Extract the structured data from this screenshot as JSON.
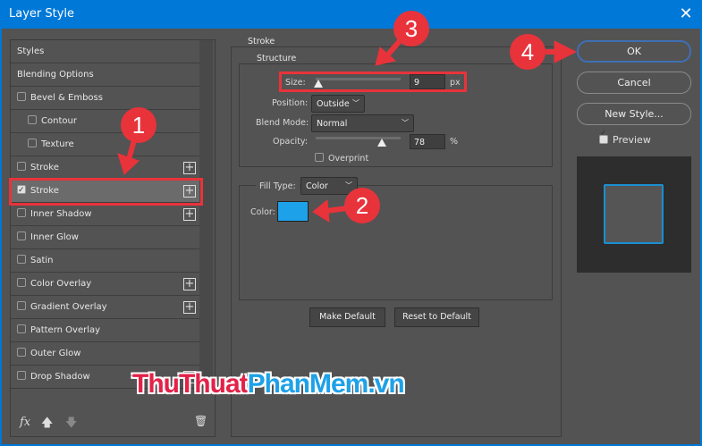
{
  "window": {
    "title": "Layer Style",
    "close": "✕"
  },
  "styles_list": [
    {
      "label": "Styles",
      "checkbox": null,
      "checked": false,
      "plus": false,
      "indent": false
    },
    {
      "label": "Blending Options",
      "checkbox": null,
      "checked": false,
      "plus": false,
      "indent": false
    },
    {
      "label": "Bevel & Emboss",
      "checkbox": true,
      "checked": false,
      "plus": false,
      "indent": false
    },
    {
      "label": "Contour",
      "checkbox": true,
      "checked": false,
      "plus": false,
      "indent": true
    },
    {
      "label": "Texture",
      "checkbox": true,
      "checked": false,
      "plus": false,
      "indent": true
    },
    {
      "label": "Stroke",
      "checkbox": true,
      "checked": false,
      "plus": true,
      "indent": false
    },
    {
      "label": "Stroke",
      "checkbox": true,
      "checked": true,
      "plus": true,
      "indent": false,
      "selected": true
    },
    {
      "label": "Inner Shadow",
      "checkbox": true,
      "checked": false,
      "plus": true,
      "indent": false
    },
    {
      "label": "Inner Glow",
      "checkbox": true,
      "checked": false,
      "plus": false,
      "indent": false
    },
    {
      "label": "Satin",
      "checkbox": true,
      "checked": false,
      "plus": false,
      "indent": false
    },
    {
      "label": "Color Overlay",
      "checkbox": true,
      "checked": false,
      "plus": true,
      "indent": false
    },
    {
      "label": "Gradient Overlay",
      "checkbox": true,
      "checked": false,
      "plus": true,
      "indent": false
    },
    {
      "label": "Pattern Overlay",
      "checkbox": true,
      "checked": false,
      "plus": false,
      "indent": false
    },
    {
      "label": "Outer Glow",
      "checkbox": true,
      "checked": false,
      "plus": false,
      "indent": false
    },
    {
      "label": "Drop Shadow",
      "checkbox": true,
      "checked": false,
      "plus": true,
      "indent": false
    }
  ],
  "footer": {
    "fx": "fx",
    "up": "🡅",
    "down": "🡇",
    "trash": "🗑"
  },
  "stroke": {
    "title": "Stroke",
    "structure": {
      "title": "Structure",
      "size_label": "Size:",
      "size_value": "9",
      "size_unit": "px",
      "size_slider": 0.03,
      "position_label": "Position:",
      "position_value": "Outside",
      "blend_label": "Blend Mode:",
      "blend_value": "Normal",
      "opacity_label": "Opacity:",
      "opacity_value": "78",
      "opacity_unit": "%",
      "opacity_slider": 0.78,
      "overprint_label": "Overprint",
      "overprint_checked": false
    },
    "fill_type_label": "Fill Type:",
    "fill_type_value": "Color",
    "color_label": "Color:",
    "color": "#1da1e8",
    "make_default": "Make Default",
    "reset_default": "Reset to Default"
  },
  "buttons": {
    "ok": "OK",
    "cancel": "Cancel",
    "new_style": "New Style..."
  },
  "preview": {
    "label": "Preview",
    "checked": true,
    "stroke_color": "#1a8fd0"
  },
  "annotations": [
    "1",
    "2",
    "3",
    "4"
  ],
  "watermark": {
    "part1": "ThuThuat",
    "part2": "PhanMem.vn",
    "color1": "#e32249",
    "color2": "#1ea1e8"
  }
}
